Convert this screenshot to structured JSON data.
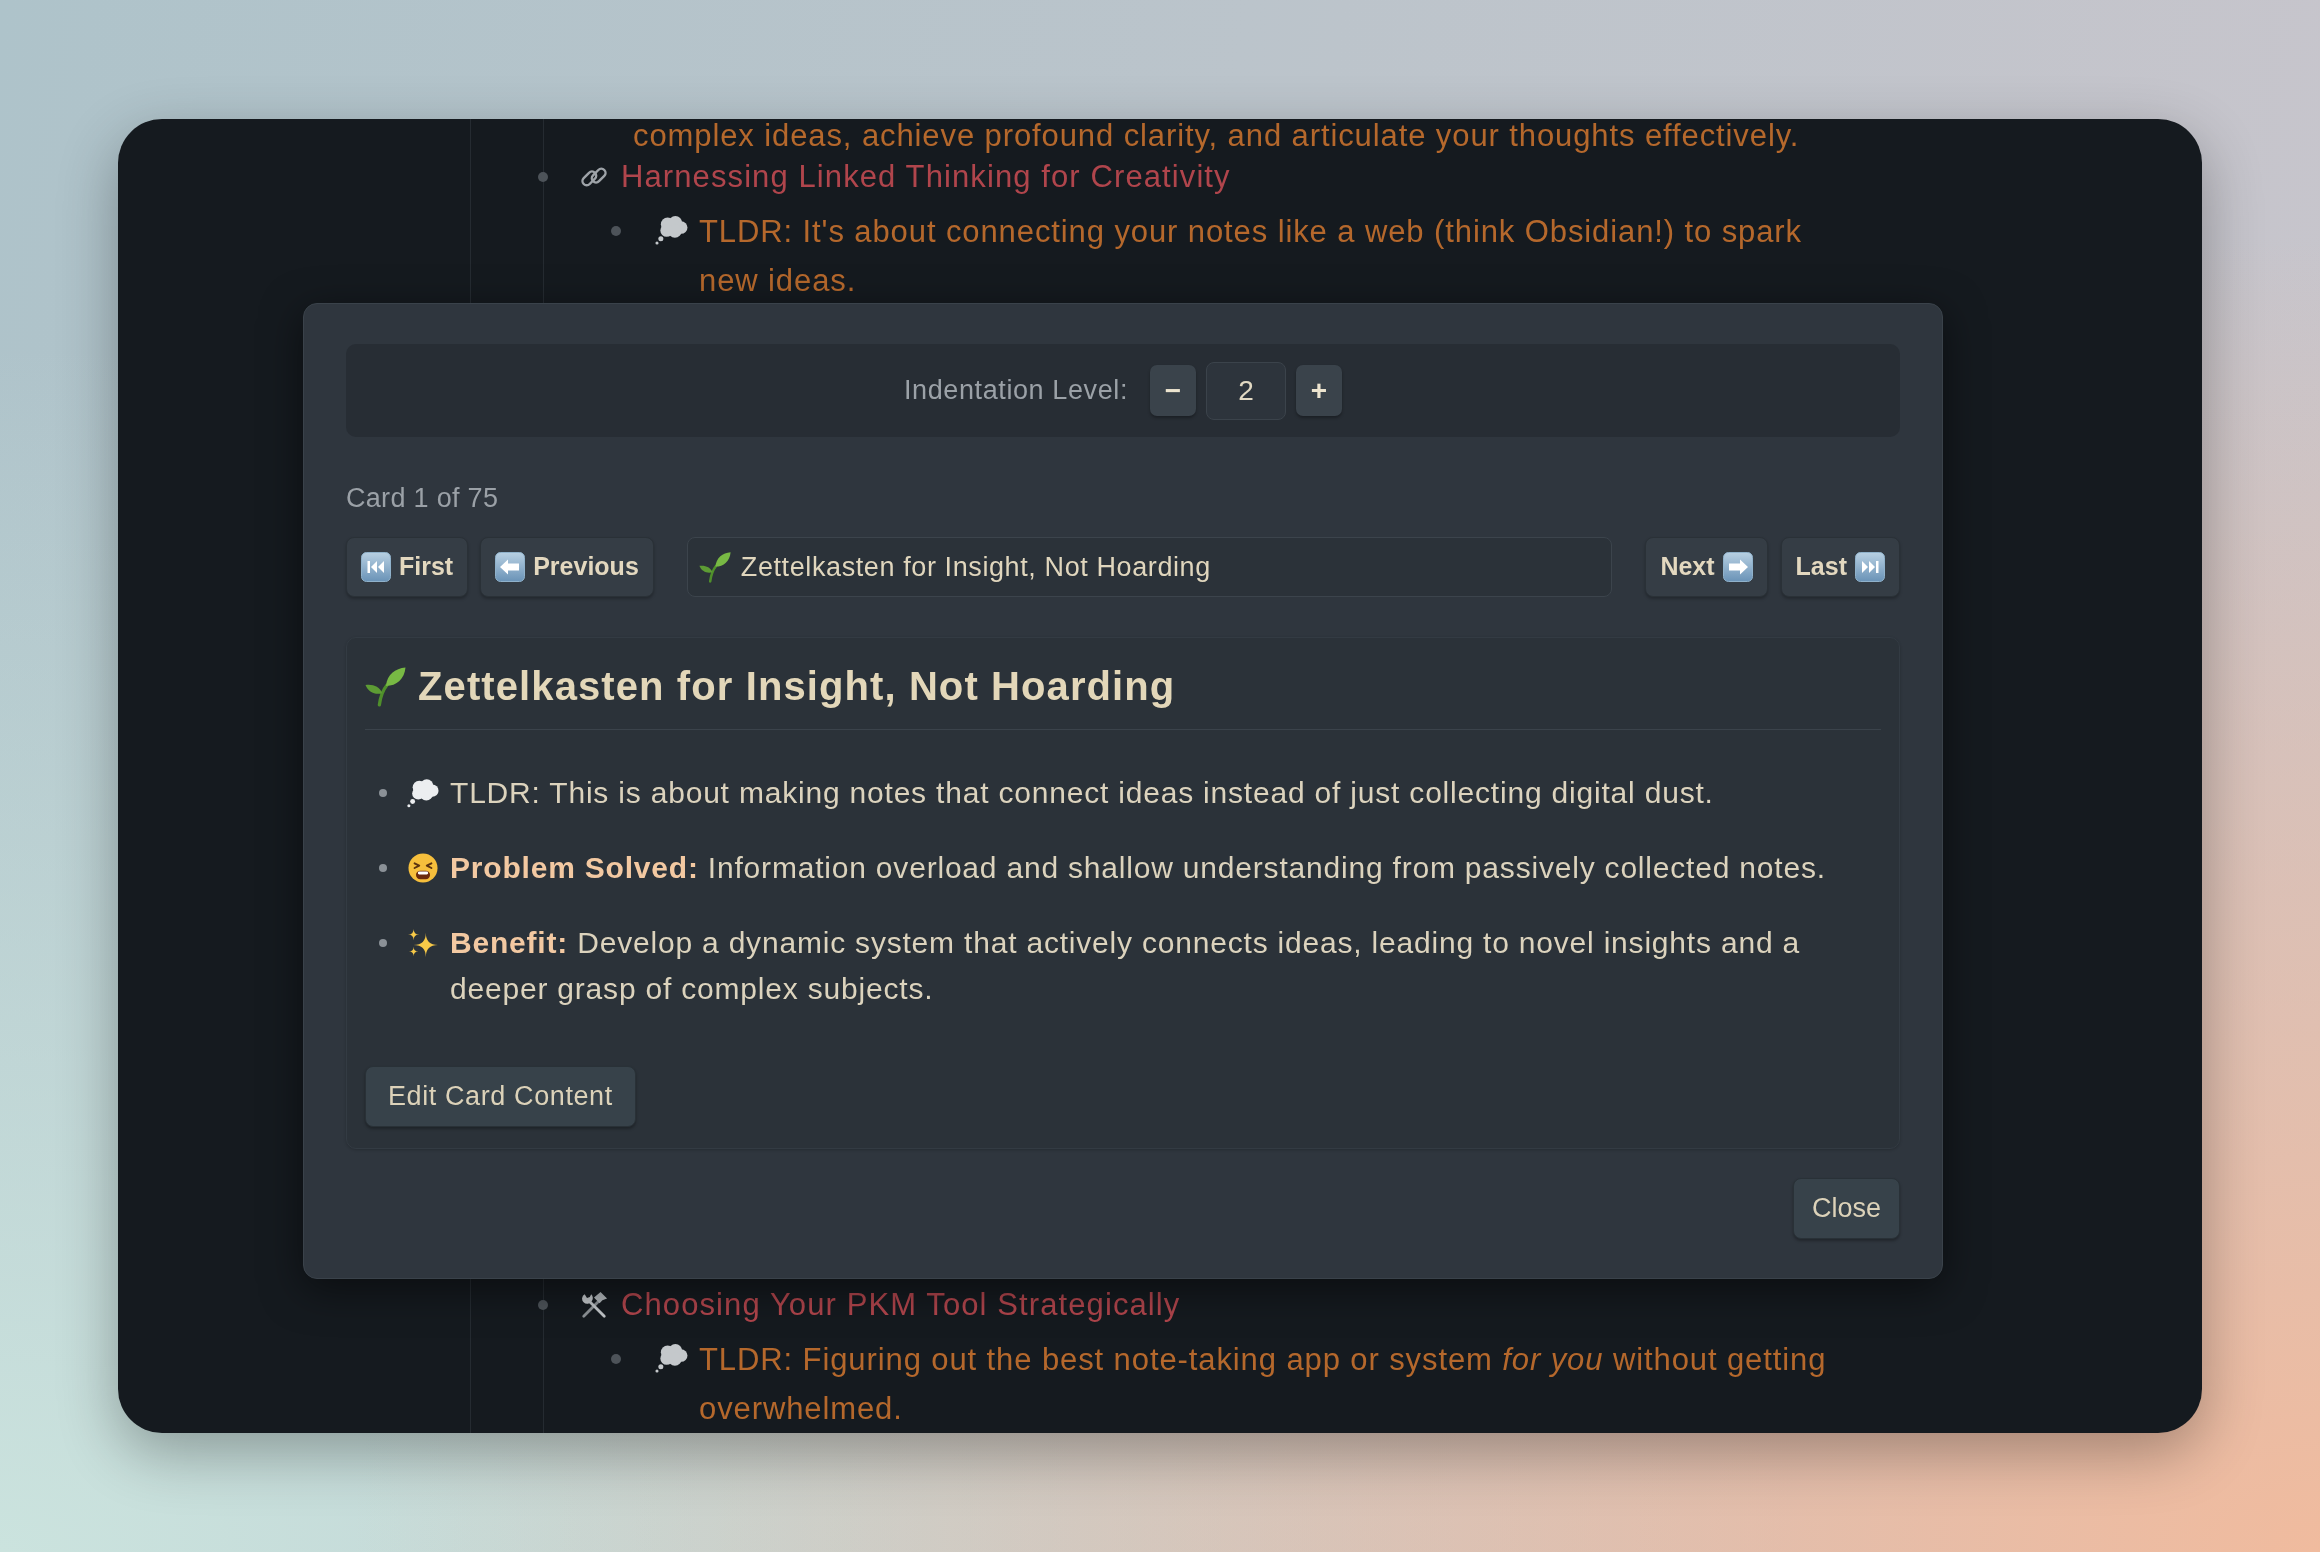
{
  "outline": {
    "top": {
      "continued_text": "complex ideas, achieve profound clarity, and articulate your thoughts effectively.",
      "items": [
        {
          "title": "Harnessing Linked Thinking for Creativity",
          "children": [
            {
              "text": "TLDR: It's about connecting your notes like a web (think Obsidian!) to spark new ideas."
            }
          ]
        }
      ]
    },
    "bottom": {
      "items": [
        {
          "title": "Choosing Your PKM Tool Strategically",
          "children": [
            {
              "text": "TLDR: Figuring out the best note-taking app or system *for you* without getting overwhelmed."
            }
          ]
        }
      ]
    }
  },
  "dialog": {
    "indentation": {
      "label": "Indentation Level:",
      "decrement": "−",
      "value": "2",
      "increment": "+"
    },
    "counter": "Card 1 of 75",
    "nav": {
      "first": "First",
      "previous": "Previous",
      "title": "Zettelkasten for Insight, Not Hoarding",
      "next": "Next",
      "last": "Last"
    },
    "card": {
      "heading": "Zettelkasten for Insight, Not Hoarding",
      "bullets": [
        "TLDR: This is about making notes that connect ideas instead of just collecting digital dust.",
        "**Problem Solved:** Information overload and shallow understanding from passively collected notes.",
        "**Benefit:** Develop a dynamic system that actively connects ideas, leading to novel insights and a deeper grasp of complex subjects."
      ],
      "edit_button": "Edit Card Content"
    },
    "close_button": "Close"
  }
}
